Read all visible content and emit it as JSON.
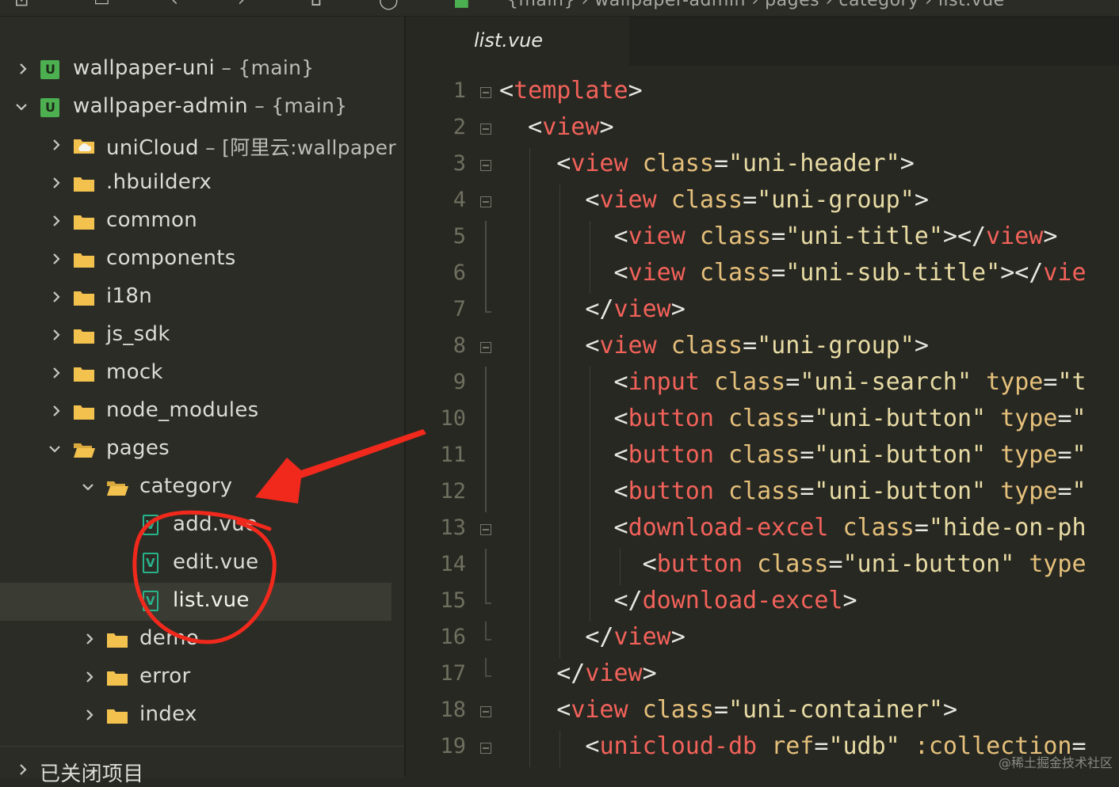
{
  "crumb": "{main} › wallpaper-admin › pages › category › list.vue",
  "sidebar": {
    "projects": [
      {
        "name": "wallpaper-uni",
        "suffix": " – {main}",
        "expanded": false
      },
      {
        "name": "wallpaper-admin",
        "suffix": " – {main}",
        "expanded": true
      }
    ],
    "folders": [
      {
        "name": "uniCloud",
        "suffix": " – [阿里云:wallpaper",
        "icon": "cloud-folder-icon"
      },
      {
        "name": ".hbuilderx"
      },
      {
        "name": "common"
      },
      {
        "name": "components"
      },
      {
        "name": "i18n"
      },
      {
        "name": "js_sdk"
      },
      {
        "name": "mock"
      },
      {
        "name": "node_modules"
      },
      {
        "name": "pages",
        "expanded": true
      }
    ],
    "category": {
      "name": "category",
      "expanded": true
    },
    "files": [
      "add.vue",
      "edit.vue",
      "list.vue"
    ],
    "subfolders": [
      "demo",
      "error",
      "index"
    ],
    "closed_projects": "已关闭项目"
  },
  "editor": {
    "tab": "list.vue",
    "line_numbers": [
      "1",
      "2",
      "3",
      "4",
      "5",
      "6",
      "7",
      "8",
      "9",
      "10",
      "11",
      "12",
      "13",
      "14",
      "15",
      "16",
      "17",
      "18",
      "19"
    ]
  },
  "watermark": "@稀土掘金技术社区"
}
